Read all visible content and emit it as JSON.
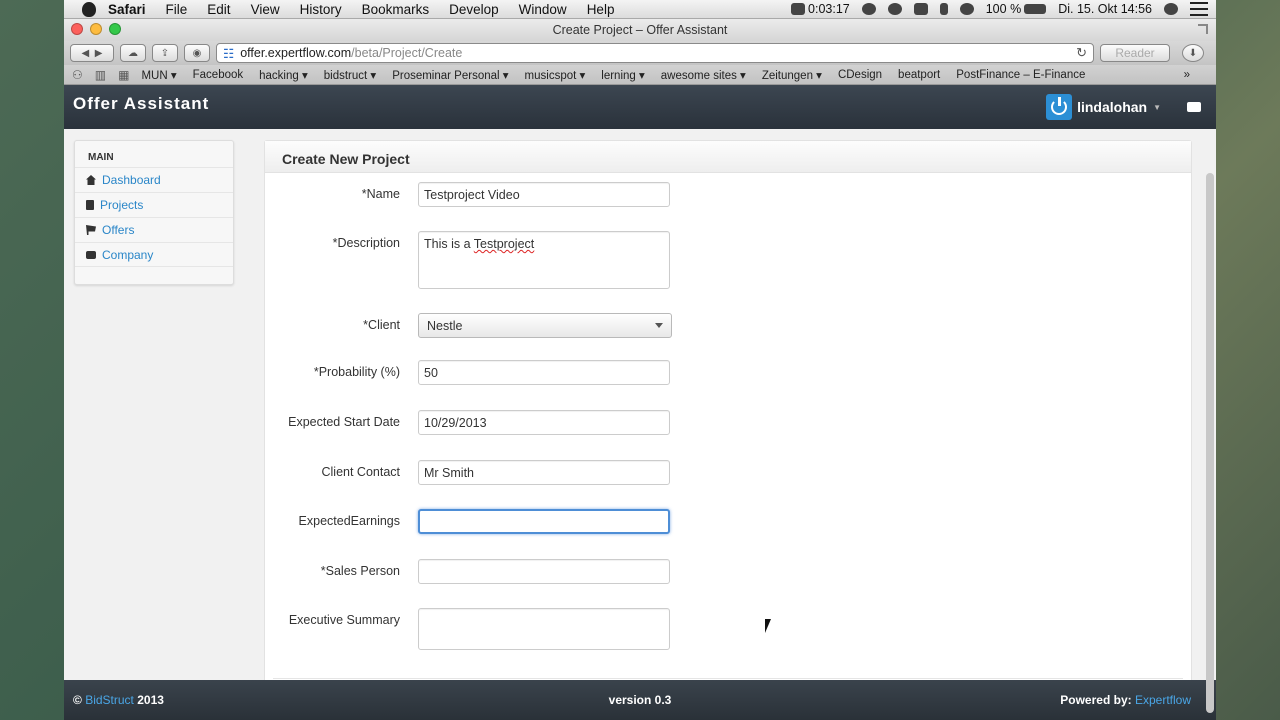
{
  "menubar": {
    "app": "Safari",
    "items": [
      "File",
      "Edit",
      "View",
      "History",
      "Bookmarks",
      "Develop",
      "Window",
      "Help"
    ],
    "timer": "0:03:17",
    "battery": "100 %",
    "datetime": "Di. 15. Okt  14:56"
  },
  "window": {
    "title": "Create Project – Offer Assistant"
  },
  "toolbar": {
    "url_host": "offer.expertflow.com",
    "url_path": "/beta/Project/Create",
    "reader_label": "Reader"
  },
  "bookmarks": [
    "MUN ▾",
    "Facebook",
    "hacking ▾",
    "bidstruct ▾",
    "Proseminar Personal ▾",
    "musicspot ▾",
    "lerning ▾",
    "awesome sites ▾",
    "Zeitungen ▾",
    "CDesign",
    "beatport",
    "PostFinance – E-Finance"
  ],
  "app": {
    "brand": "Offer Assistant",
    "user": "lindalohan"
  },
  "sidebar": {
    "header": "MAIN",
    "items": [
      {
        "label": "Dashboard",
        "icon": "home-icon"
      },
      {
        "label": "Projects",
        "icon": "book-icon"
      },
      {
        "label": "Offers",
        "icon": "cart-icon"
      },
      {
        "label": "Company",
        "icon": "briefcase-icon"
      }
    ]
  },
  "form": {
    "title": "Create New Project",
    "name": {
      "label": "*Name",
      "value": "Testproject Video"
    },
    "description": {
      "label": "*Description",
      "value_prefix": "This is a ",
      "value_misspelled": "Testproject"
    },
    "client": {
      "label": "*Client",
      "value": "Nestle"
    },
    "probability": {
      "label": "*Probability (%)",
      "value": "50"
    },
    "start_date": {
      "label": "Expected Start Date",
      "value": "10/29/2013"
    },
    "client_contact": {
      "label": "Client Contact",
      "value": "Mr Smith"
    },
    "expected_earnings": {
      "label": "ExpectedEarnings",
      "value": ""
    },
    "sales_person": {
      "label": "*Sales Person",
      "value": ""
    },
    "executive_summary": {
      "label": "Executive Summary",
      "value": ""
    }
  },
  "footer": {
    "copyright_symbol": "©",
    "brand_link": "BidStruct",
    "year": "2013",
    "version": "version 0.3",
    "powered_label": "Powered by:",
    "powered_link": "Expertflow"
  }
}
